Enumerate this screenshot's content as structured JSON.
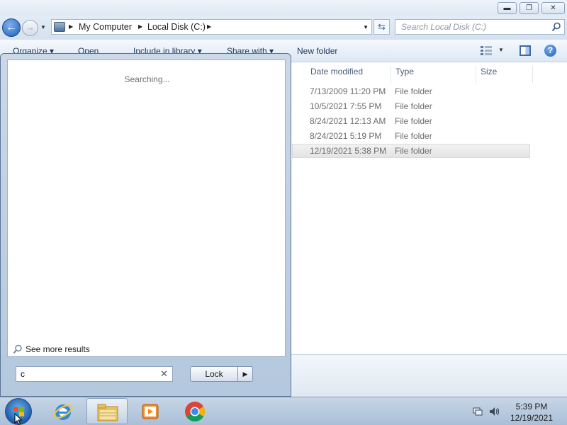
{
  "window": {
    "caption": {
      "minimize": "▬",
      "maximize": "❐",
      "close": "✕"
    },
    "address": {
      "segments": [
        "My Computer",
        "Local Disk (C:)"
      ]
    },
    "search": {
      "placeholder": "Search Local Disk (C:)"
    },
    "toolbar": {
      "organize": "Organize ▾",
      "open": "Open",
      "include": "Include in library ▾",
      "share": "Share with ▾",
      "new_folder": "New folder"
    },
    "columns": [
      "Date modified",
      "Type",
      "Size"
    ],
    "rows": [
      {
        "date": "7/13/2009 11:20 PM",
        "type": "File folder"
      },
      {
        "date": "10/5/2021 7:55 PM",
        "type": "File folder"
      },
      {
        "date": "8/24/2021 12:13 AM",
        "type": "File folder"
      },
      {
        "date": "8/24/2021 5:19 PM",
        "type": "File folder"
      },
      {
        "date": "12/19/2021 5:38 PM",
        "type": "File folder",
        "selected": true
      }
    ]
  },
  "start_menu": {
    "status": "Searching...",
    "see_more": "See more results",
    "search_value": "c",
    "clear": "✕",
    "lock_label": "Lock",
    "lock_arrow": "▶"
  },
  "taskbar": {
    "apps": [
      "internet-explorer",
      "windows-explorer",
      "media-player",
      "chrome"
    ],
    "clock": {
      "time": "5:39 PM",
      "date": "12/19/2021"
    }
  },
  "colors": {
    "accent": "#1d5fb8",
    "taskbar": "#b4c8de",
    "text": "#1e395b"
  }
}
